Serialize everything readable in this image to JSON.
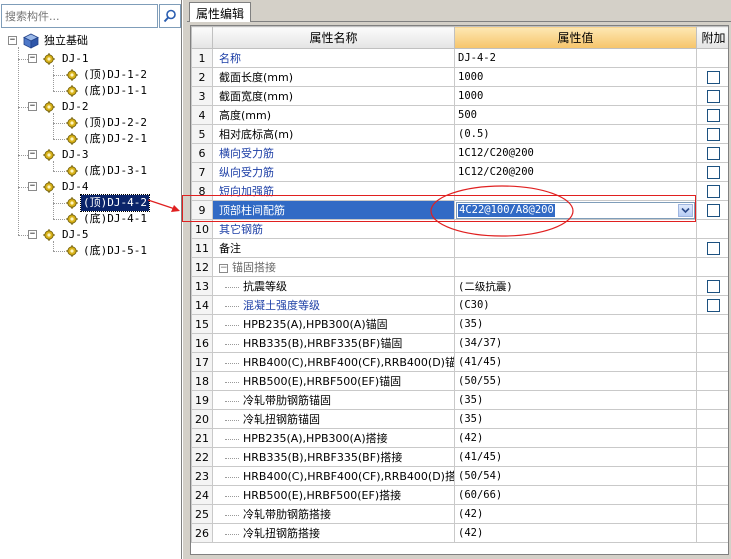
{
  "search": {
    "placeholder": "搜索构件..."
  },
  "tree": {
    "root": "独立基础",
    "groups": [
      {
        "name": "DJ-1",
        "children": [
          "(顶)DJ-1-2",
          "(底)DJ-1-1"
        ]
      },
      {
        "name": "DJ-2",
        "children": [
          "(顶)DJ-2-2",
          "(底)DJ-2-1"
        ]
      },
      {
        "name": "DJ-3",
        "children": [
          "(底)DJ-3-1"
        ]
      },
      {
        "name": "DJ-4",
        "children": [
          "(顶)DJ-4-2",
          "(底)DJ-4-1"
        ]
      },
      {
        "name": "DJ-5",
        "children": [
          "(底)DJ-5-1"
        ]
      }
    ],
    "selected": "(顶)DJ-4-2"
  },
  "tab": {
    "label": "属性编辑"
  },
  "grid": {
    "headers": {
      "name": "属性名称",
      "value": "属性值",
      "attach": "附加"
    },
    "rows": [
      {
        "num": "1",
        "name": "名称",
        "value": "DJ-4-2",
        "blue": true,
        "check": false
      },
      {
        "num": "2",
        "name": "截面长度(mm)",
        "value": "1000",
        "check": true
      },
      {
        "num": "3",
        "name": "截面宽度(mm)",
        "value": "1000",
        "check": true
      },
      {
        "num": "4",
        "name": "高度(mm)",
        "value": "500",
        "check": true
      },
      {
        "num": "5",
        "name": "相对底标高(m)",
        "value": "(0.5)",
        "check": true
      },
      {
        "num": "6",
        "name": "横向受力筋",
        "value": "1C12/C20@200",
        "blue": true,
        "check": true
      },
      {
        "num": "7",
        "name": "纵向受力筋",
        "value": "1C12/C20@200",
        "blue": true,
        "check": true
      },
      {
        "num": "8",
        "name": "短向加强筋",
        "value": "",
        "blue": true,
        "check": true
      },
      {
        "num": "9",
        "name": "顶部柱间配筋",
        "value": "4C22@100/A8@200",
        "selected": true,
        "check": true
      },
      {
        "num": "10",
        "name": "其它钢筋",
        "value": "",
        "blue": true,
        "check": false
      },
      {
        "num": "11",
        "name": "备注",
        "value": "",
        "check": true
      },
      {
        "num": "12",
        "name": "锚固搭接",
        "value": "",
        "group": true,
        "check": false
      },
      {
        "num": "13",
        "name": "抗震等级",
        "value": "(二级抗震)",
        "sub": true,
        "check": true
      },
      {
        "num": "14",
        "name": "混凝土强度等级",
        "value": "(C30)",
        "sub": true,
        "blue": true,
        "check": true
      },
      {
        "num": "15",
        "name": "HPB235(A),HPB300(A)锚固",
        "value": "(35)",
        "sub": true,
        "check": false
      },
      {
        "num": "16",
        "name": "HRB335(B),HRBF335(BF)锚固",
        "value": "(34/37)",
        "sub": true,
        "check": false
      },
      {
        "num": "17",
        "name": "HRB400(C),HRBF400(CF),RRB400(D)锚",
        "value": "(41/45)",
        "sub": true,
        "check": false
      },
      {
        "num": "18",
        "name": "HRB500(E),HRBF500(EF)锚固",
        "value": "(50/55)",
        "sub": true,
        "check": false
      },
      {
        "num": "19",
        "name": "冷轧带肋钢筋锚固",
        "value": "(35)",
        "sub": true,
        "check": false
      },
      {
        "num": "20",
        "name": "冷轧扭钢筋锚固",
        "value": "(35)",
        "sub": true,
        "check": false
      },
      {
        "num": "21",
        "name": "HPB235(A),HPB300(A)搭接",
        "value": "(42)",
        "sub": true,
        "check": false
      },
      {
        "num": "22",
        "name": "HRB335(B),HRBF335(BF)搭接",
        "value": "(41/45)",
        "sub": true,
        "check": false
      },
      {
        "num": "23",
        "name": "HRB400(C),HRBF400(CF),RRB400(D)搭",
        "value": "(50/54)",
        "sub": true,
        "check": false
      },
      {
        "num": "24",
        "name": "HRB500(E),HRBF500(EF)搭接",
        "value": "(60/66)",
        "sub": true,
        "check": false
      },
      {
        "num": "25",
        "name": "冷轧带肋钢筋搭接",
        "value": "(42)",
        "sub": true,
        "check": false
      },
      {
        "num": "26",
        "name": "冷轧扭钢筋搭接",
        "value": "(42)",
        "sub": true,
        "check": false
      }
    ]
  },
  "icons": {
    "search": "magnifier-icon",
    "foundation": "foundation-cube-icon",
    "component": "gear-icon",
    "dropdown": "chevron-down-icon"
  },
  "colors": {
    "selection": "#316ac5",
    "tree_selection": "#0a246a",
    "annotation": "#e02020",
    "name_blue": "#1c3ea6",
    "value_header": "#f6c46a"
  }
}
